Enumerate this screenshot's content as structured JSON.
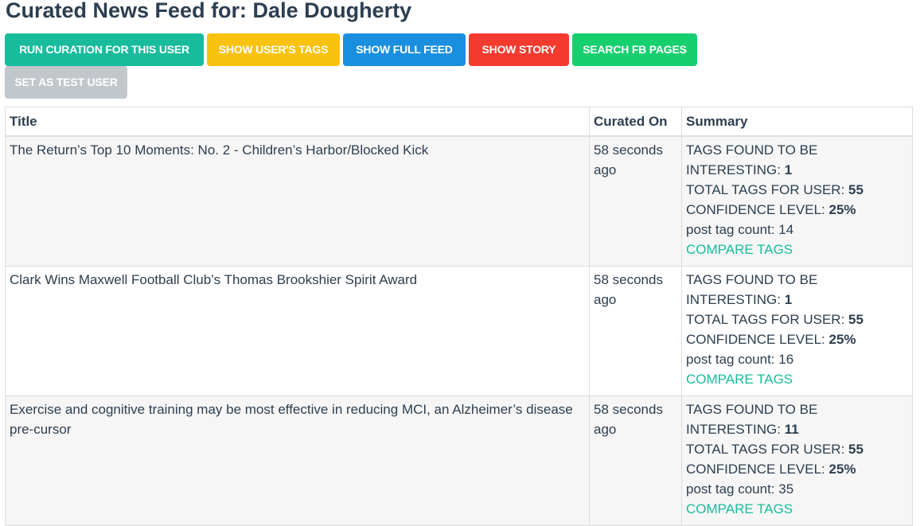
{
  "page": {
    "title": "Curated News Feed for: Dale Dougherty"
  },
  "toolbar": {
    "run_curation": "RUN CURATION FOR THIS USER",
    "show_tags": "SHOW USER'S TAGS",
    "show_full_feed": "SHOW FULL FEED",
    "show_story": "SHOW STORY",
    "search_fb": "SEARCH FB PAGES",
    "set_test_user": "SET AS TEST USER"
  },
  "colors": {
    "run_curation": "#18bc9c",
    "show_tags": "#f9c20e",
    "show_full_feed": "#1a8fdf",
    "show_story": "#f23b2e",
    "search_fb": "#16cf6e",
    "set_test_user": "#c2c7cc",
    "link": "#18bc9c"
  },
  "table": {
    "headers": {
      "title": "Title",
      "curated_on": "Curated On",
      "summary": "Summary"
    },
    "rows": [
      {
        "title": "The Return’s Top 10 Moments: No. 2 - Children’s Harbor/Blocked Kick",
        "curated_on": "58 seconds ago",
        "interesting_label": "TAGS FOUND TO BE INTERESTING:",
        "interesting": "1",
        "total_label": "TOTAL TAGS FOR USER:",
        "total": "55",
        "confidence_label": "CONFIDENCE LEVEL:",
        "confidence": "25%",
        "post_count_label": "post tag count:",
        "post_count": "14",
        "compare": "COMPARE TAGS"
      },
      {
        "title": "Clark Wins Maxwell Football Club’s Thomas Brookshier Spirit Award",
        "curated_on": "58 seconds ago",
        "interesting_label": "TAGS FOUND TO BE INTERESTING:",
        "interesting": "1",
        "total_label": "TOTAL TAGS FOR USER:",
        "total": "55",
        "confidence_label": "CONFIDENCE LEVEL:",
        "confidence": "25%",
        "post_count_label": "post tag count:",
        "post_count": "16",
        "compare": "COMPARE TAGS"
      },
      {
        "title": "Exercise and cognitive training may be most effective in reducing MCI, an Alzheimer’s disease pre-cursor",
        "curated_on": "58 seconds ago",
        "interesting_label": "TAGS FOUND TO BE INTERESTING:",
        "interesting": "11",
        "total_label": "TOTAL TAGS FOR USER:",
        "total": "55",
        "confidence_label": "CONFIDENCE LEVEL:",
        "confidence": "25%",
        "post_count_label": "post tag count:",
        "post_count": "35",
        "compare": "COMPARE TAGS"
      }
    ]
  }
}
